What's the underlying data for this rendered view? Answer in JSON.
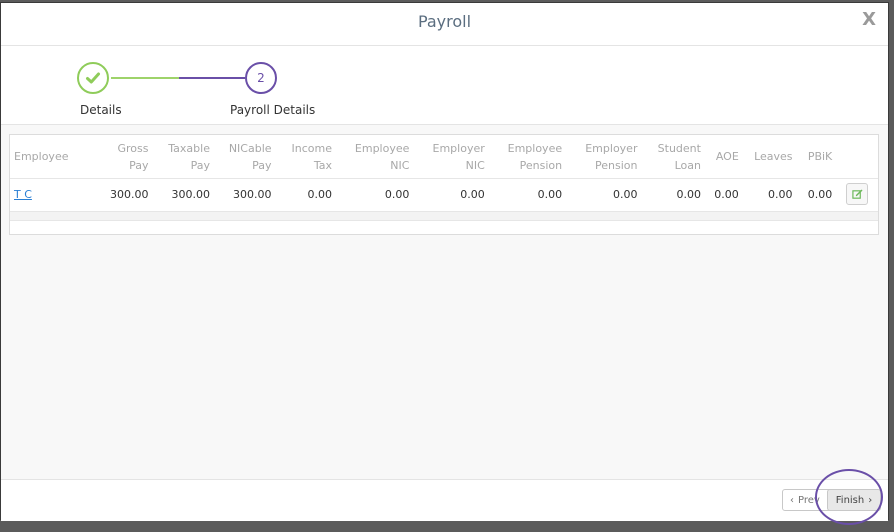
{
  "modal": {
    "title": "Payroll",
    "close_label": "X"
  },
  "wizard": {
    "steps": [
      {
        "label": "Details",
        "status": "complete",
        "icon": "check-icon"
      },
      {
        "label": "Payroll Details",
        "number": "2",
        "status": "active"
      }
    ],
    "colors": {
      "complete": "#8fcc5a",
      "active": "#6a4fa8"
    }
  },
  "table": {
    "headers": [
      [
        "Employee",
        ""
      ],
      [
        "Gross",
        "Pay"
      ],
      [
        "Taxable",
        "Pay"
      ],
      [
        "NICable",
        "Pay"
      ],
      [
        "Income",
        "Tax"
      ],
      [
        "Employee",
        "NIC"
      ],
      [
        "Employer",
        "NIC"
      ],
      [
        "Employee",
        "Pension"
      ],
      [
        "Employer",
        "Pension"
      ],
      [
        "Student",
        "Loan"
      ],
      [
        "AOE",
        ""
      ],
      [
        "Leaves",
        ""
      ],
      [
        "PBiK",
        ""
      ]
    ],
    "rows": [
      {
        "employee": "T C",
        "gross_pay": "300.00",
        "taxable_pay": "300.00",
        "nicable_pay": "300.00",
        "income_tax": "0.00",
        "employee_nic": "0.00",
        "employer_nic": "0.00",
        "employee_pension": "0.00",
        "employer_pension": "0.00",
        "student_loan": "0.00",
        "aoe": "0.00",
        "leaves": "0.00",
        "pbik": "0.00",
        "action_icon": "edit-icon"
      }
    ]
  },
  "footer": {
    "prev_label": "Prev",
    "finish_label": "Finish"
  }
}
